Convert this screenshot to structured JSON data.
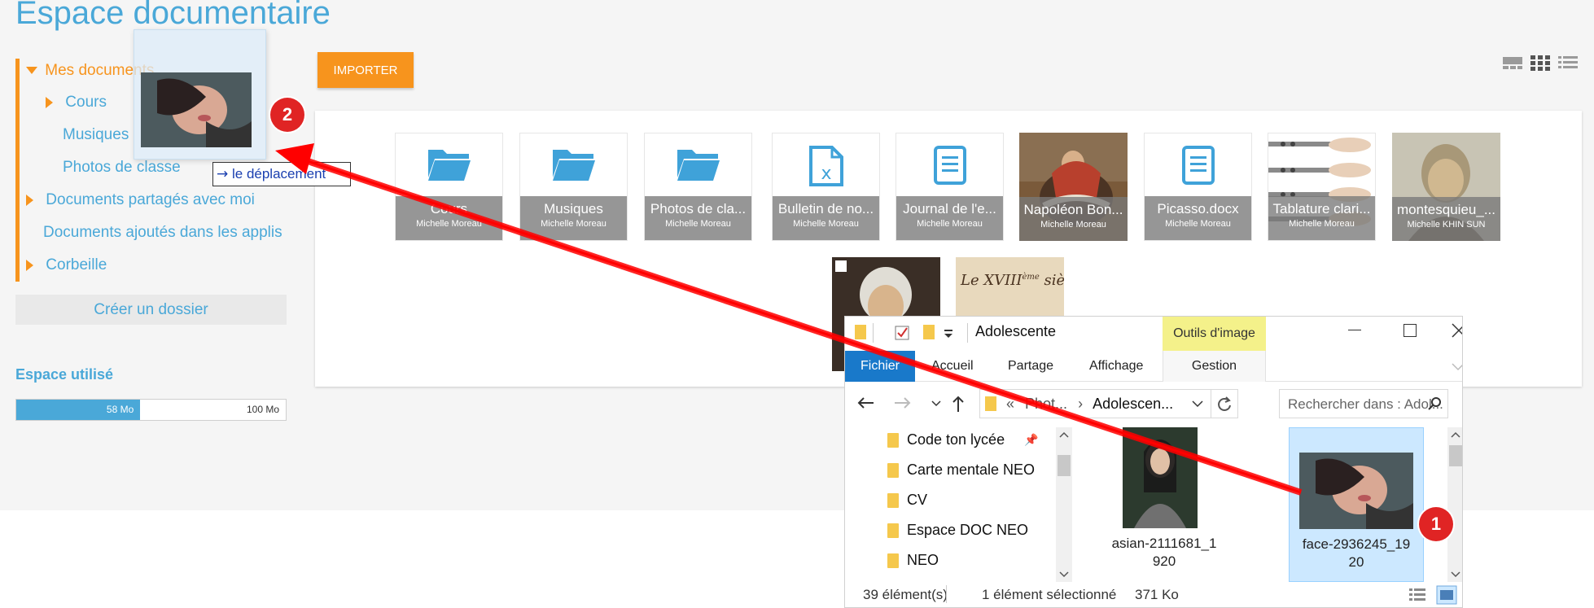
{
  "page": {
    "title": "Espace documentaire"
  },
  "sidebar": {
    "items": [
      {
        "label": "Mes documents"
      },
      {
        "label": "Cours"
      },
      {
        "label": "Musiques"
      },
      {
        "label": "Photos de classe"
      },
      {
        "label": "Documents partagés avec moi"
      },
      {
        "label": "Documents ajoutés dans les applis"
      },
      {
        "label": "Corbeille"
      }
    ],
    "create_folder": "Créer un dossier",
    "space_title": "Espace utilisé",
    "space_used": "58 Mo",
    "space_total": "100 Mo",
    "space_fraction": 0.46
  },
  "toolbar": {
    "import_label": "IMPORTER"
  },
  "documents": [
    {
      "name": "Cours",
      "owner": "Michelle Moreau",
      "icon": "folder-icon"
    },
    {
      "name": "Musiques",
      "owner": "Michelle Moreau",
      "icon": "folder-icon"
    },
    {
      "name": "Photos de cla...",
      "owner": "Michelle Moreau",
      "icon": "folder-icon"
    },
    {
      "name": "Bulletin de no...",
      "owner": "Michelle Moreau",
      "icon": "excel-file-icon"
    },
    {
      "name": "Journal de l'e...",
      "owner": "Michelle Moreau",
      "icon": "document-icon"
    },
    {
      "name": "Napoléon Bon...",
      "owner": "Michelle Moreau",
      "icon": "image-thumbnail"
    },
    {
      "name": "Picasso.docx",
      "owner": "Michelle Moreau",
      "icon": "document-icon"
    },
    {
      "name": "Tablature clari...",
      "owner": "Michelle Moreau",
      "icon": "image-thumbnail"
    },
    {
      "name": "montesquieu_...",
      "owner": "Michelle KHIN SUN",
      "icon": "image-thumbnail"
    }
  ],
  "drag": {
    "tooltip": "le déplacement",
    "badge_1": "1",
    "badge_2": "2",
    "second_row_label": "Le XVIII",
    "second_row_label_sup": "ème",
    "second_row_label_end": " siècle"
  },
  "explorer": {
    "title": "Adolescente",
    "tools_label": "Outils d'image",
    "tabs": [
      "Fichier",
      "Accueil",
      "Partage",
      "Affichage",
      "Gestion"
    ],
    "breadcrumb": [
      "«",
      "Phot...",
      "Adolescen..."
    ],
    "search_placeholder": "Rechercher dans : Adol...",
    "nav_items": [
      "Code ton lycée",
      "Carte mentale NEO",
      "CV",
      "Espace DOC NEO",
      "NEO"
    ],
    "files": [
      {
        "name": "asian-2111681_1920",
        "line1": "asian-2111681_1",
        "line2": "920"
      },
      {
        "name": "face-2936245_1920",
        "line1": "face-2936245_19",
        "line2": "20"
      }
    ],
    "status_count": "39 élément(s)",
    "status_selected": "1 élément sélectionné",
    "status_size": "371 Ko"
  },
  "colors": {
    "accent_blue": "#4aa8d8",
    "accent_orange": "#f7941d",
    "badge_red": "#e02424",
    "arrow_red": "#ff0000",
    "explorer_blue": "#1979ca"
  }
}
